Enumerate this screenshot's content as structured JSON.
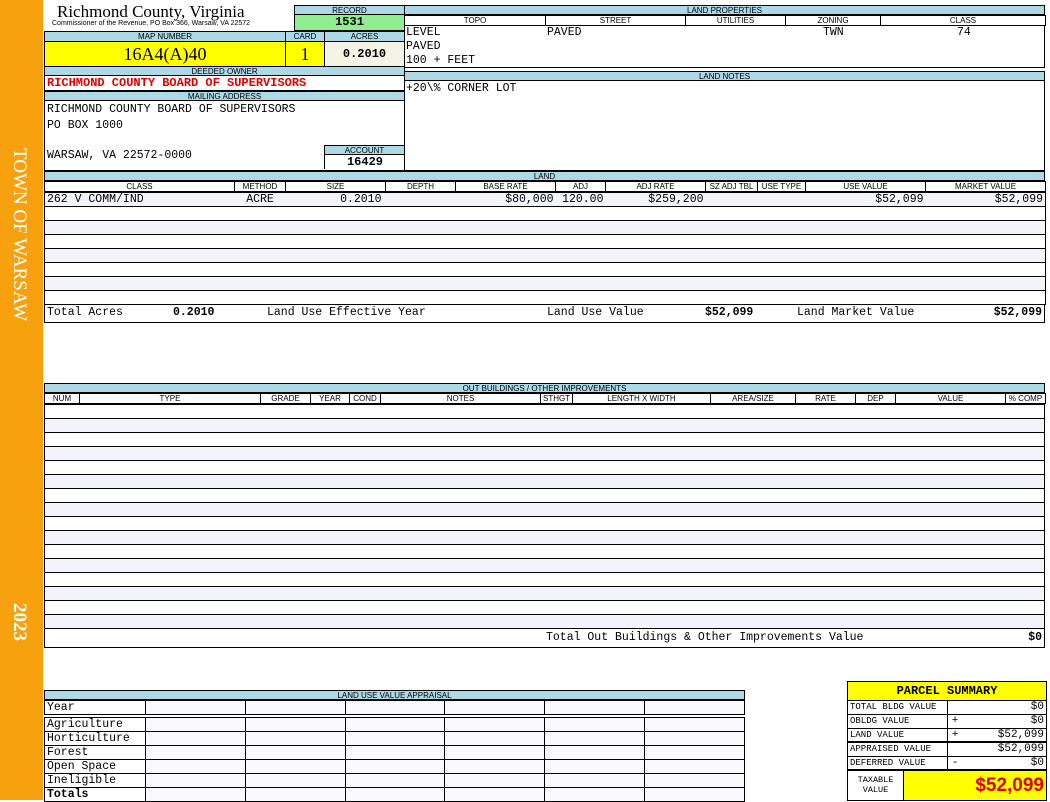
{
  "sidebar": {
    "town": "TOWN OF WARSAW",
    "year": "2023"
  },
  "header": {
    "title": "Richmond County, Virginia",
    "subtitle": "Commissioner of the Revenue, PO Box 366, Warsaw, VA 22572",
    "record_label": "RECORD",
    "record": "1531",
    "map_label": "MAP NUMBER",
    "map_number": "16A4(A)40",
    "card_label": "CARD",
    "card": "1",
    "acres_label": "ACRES",
    "acres": "0.2010"
  },
  "owner": {
    "label": "DEEDED OWNER",
    "name": "RICHMOND COUNTY BOARD OF SUPERVISORS",
    "mailing_label": "MAILING ADDRESS",
    "address": [
      "RICHMOND COUNTY BOARD OF SUPERVISORS",
      "PO BOX  1000",
      "",
      "WARSAW, VA 22572-0000"
    ],
    "account_label": "ACCOUNT",
    "account": "16429"
  },
  "land_properties": {
    "title": "LAND PROPERTIES",
    "columns": [
      "TOPO",
      "STREET",
      "UTILITIES",
      "ZONING",
      "CLASS"
    ],
    "topo": [
      "LEVEL",
      "PAVED",
      "100 + FEET"
    ],
    "street": "PAVED",
    "utilities": "",
    "zoning": "TWN",
    "class": "74"
  },
  "land_notes": {
    "title": "LAND NOTES",
    "text": "+20\\% CORNER LOT"
  },
  "land": {
    "title": "LAND",
    "columns": [
      "CLASS",
      "METHOD",
      "SIZE",
      "DEPTH",
      "BASE RATE",
      "ADJ",
      "ADJ RATE",
      "SZ ADJ TBL",
      "USE TYPE",
      "USE VALUE",
      "MARKET VALUE"
    ],
    "rows": [
      [
        "262 V COMM/IND",
        "ACRE",
        "0.2010",
        "",
        "$80,000",
        "120.00",
        "$259,200",
        "",
        "",
        "$52,099",
        "$52,099"
      ]
    ],
    "total_acres_label": "Total Acres",
    "total_acres": "0.2010",
    "effective_year_label": "Land Use Effective Year",
    "effective_year": "",
    "use_value_label": "Land Use Value",
    "use_value": "$52,099",
    "market_value_label": "Land Market Value",
    "market_value": "$52,099"
  },
  "outbuildings": {
    "title": "OUT BUILDINGS / OTHER IMPROVEMENTS",
    "columns": [
      "NUM",
      "TYPE",
      "GRADE",
      "YEAR",
      "COND",
      "NOTES",
      "STHGT",
      "LENGTH X WIDTH",
      "AREA/SIZE",
      "RATE",
      "DEP",
      "VALUE",
      "% COMP"
    ],
    "total_label": "Total Out Buildings & Other Improvements Value",
    "total": "$0"
  },
  "land_use": {
    "title": "LAND USE VALUE APPRAISAL",
    "year_label": "Year",
    "rows": [
      "Agriculture",
      "Horticulture",
      "Forest",
      "Open Space",
      "Ineligible"
    ],
    "totals_label": "Totals"
  },
  "parcel_summary": {
    "title": "PARCEL SUMMARY",
    "rows": [
      {
        "label": "TOTAL BLDG VALUE",
        "op": "",
        "value": "$0"
      },
      {
        "label": "OBLDG VALUE",
        "op": "+",
        "value": "$0"
      },
      {
        "label": "LAND VALUE",
        "op": "+",
        "value": "$52,099"
      },
      {
        "label": "APPRAISED VALUE",
        "op": "",
        "value": "$52,099"
      },
      {
        "label": "DEFERRED VALUE",
        "op": "-",
        "value": "$0"
      }
    ],
    "taxable_label": "TAXABLE VALUE",
    "taxable": "$52,099"
  },
  "colors": {
    "sidebar": "#f7a10f",
    "header": "#add8e6",
    "highlight": "#ffff00",
    "record": "#90ee90",
    "owner": "#e00000"
  }
}
